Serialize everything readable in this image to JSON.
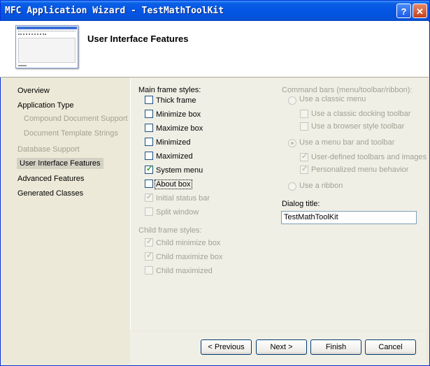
{
  "window": {
    "title": "MFC Application Wizard - TestMathToolKit"
  },
  "titlebar": {
    "help": "?",
    "close": "✕"
  },
  "header": {
    "title": "User Interface Features"
  },
  "nav": {
    "items": [
      {
        "label": "Overview",
        "state": "normal"
      },
      {
        "label": "Application Type",
        "state": "normal"
      },
      {
        "label": "Compound Document Support",
        "state": "disabled"
      },
      {
        "label": "Document Template Strings",
        "state": "disabled"
      },
      {
        "label": "Database Support",
        "state": "disabled"
      },
      {
        "label": "User Interface Features",
        "state": "selected"
      },
      {
        "label": "Advanced Features",
        "state": "normal"
      },
      {
        "label": "Generated Classes",
        "state": "normal"
      }
    ]
  },
  "main_frame": {
    "label": "Main frame styles:",
    "options": [
      {
        "label": "Thick frame",
        "checked": false,
        "enabled": true
      },
      {
        "label": "Minimize box",
        "checked": false,
        "enabled": true
      },
      {
        "label": "Maximize box",
        "checked": false,
        "enabled": true
      },
      {
        "label": "Minimized",
        "checked": false,
        "enabled": true
      },
      {
        "label": "Maximized",
        "checked": false,
        "enabled": true
      },
      {
        "label": "System menu",
        "checked": true,
        "enabled": true
      },
      {
        "label": "About box",
        "checked": false,
        "enabled": true
      },
      {
        "label": "Initial status bar",
        "checked": true,
        "enabled": false
      },
      {
        "label": "Split window",
        "checked": false,
        "enabled": false
      }
    ]
  },
  "child_frame": {
    "label": "Child frame styles:",
    "options": [
      {
        "label": "Child minimize box",
        "checked": true,
        "enabled": false
      },
      {
        "label": "Child maximize box",
        "checked": true,
        "enabled": false
      },
      {
        "label": "Child maximized",
        "checked": false,
        "enabled": false
      }
    ]
  },
  "command_bars": {
    "label": "Command bars (menu/toolbar/ribbon):",
    "classic_menu": "Use a classic menu",
    "classic_docking": "Use a classic docking toolbar",
    "browser_style": "Use a browser style toolbar",
    "menu_bar_toolbar": "Use a menu bar and toolbar",
    "user_defined": "User-defined toolbars and images",
    "personalized": "Personalized menu behavior",
    "ribbon": "Use a ribbon"
  },
  "dialog_title": {
    "label": "Dialog title:",
    "value": "TestMathToolKit"
  },
  "buttons": {
    "previous": "< Previous",
    "next": "Next >",
    "finish": "Finish",
    "cancel": "Cancel"
  }
}
